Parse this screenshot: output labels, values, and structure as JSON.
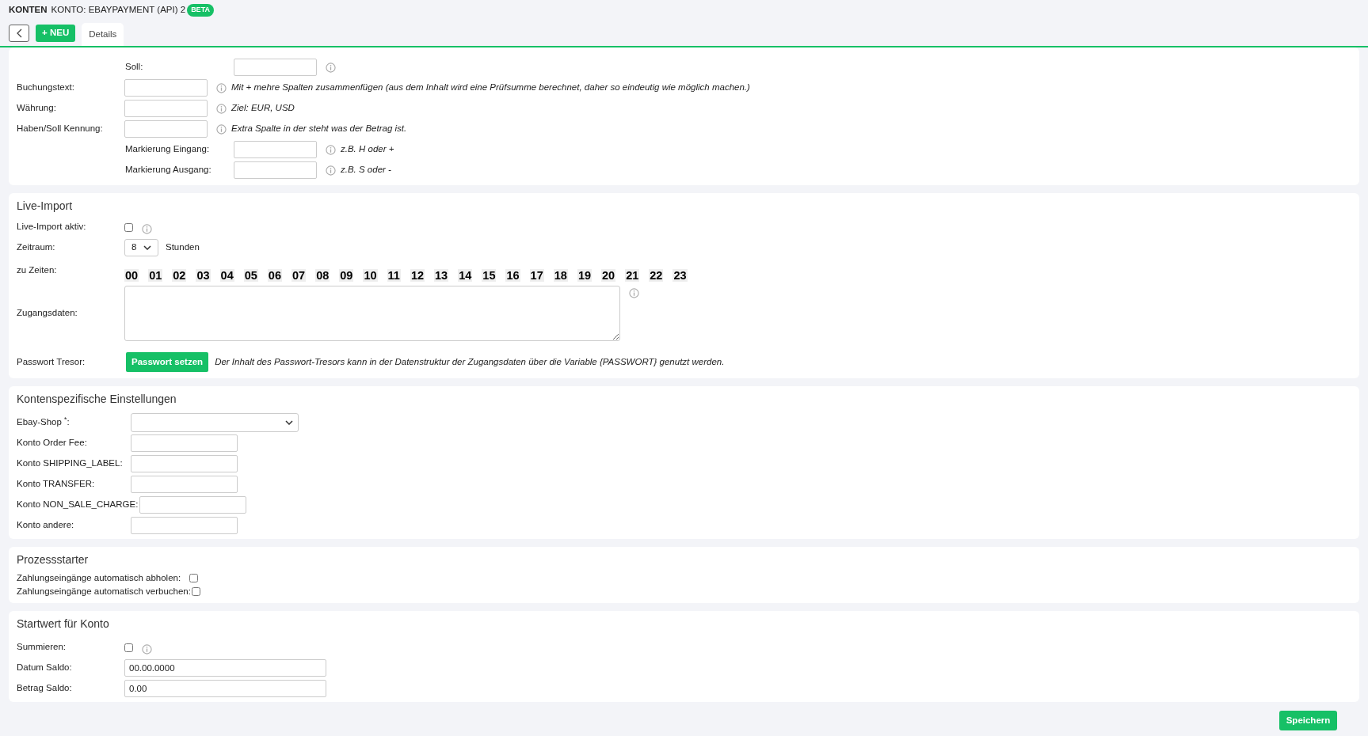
{
  "header": {
    "section": "KONTEN",
    "title": "KONTO: EBAYPAYMENT (API) 2",
    "badge": "BETA"
  },
  "toolbar": {
    "new_button": "+ NEU",
    "tabs": [
      {
        "label": "Details",
        "selected": true
      }
    ]
  },
  "mapping": [
    {
      "kind": "sub",
      "label": "Soll:"
    },
    {
      "kind": "main",
      "label": "Buchungstext:",
      "hint": "Mit + mehre Spalten zusammenfügen (aus dem Inhalt wird eine Prüfsumme berechnet, daher so eindeutig wie möglich machen.)"
    },
    {
      "kind": "main",
      "label": "Währung:",
      "hint": "Ziel: EUR, USD"
    },
    {
      "kind": "main",
      "label": "Haben/Soll Kennung:",
      "hint": "Extra Spalte in der steht was der Betrag ist."
    },
    {
      "kind": "sub",
      "label": "Markierung Eingang:",
      "hint": "z.B. H oder +"
    },
    {
      "kind": "sub",
      "label": "Markierung Ausgang:",
      "hint": "z.B. S oder -"
    }
  ],
  "live_import": {
    "title": "Live-Import",
    "active": {
      "label": "Live-Import aktiv:",
      "checked": false
    },
    "period": {
      "label": "Zeitraum:",
      "value": "8",
      "unit": "Stunden"
    },
    "times": {
      "label": "zu Zeiten:",
      "hours": [
        "00",
        "01",
        "02",
        "03",
        "04",
        "05",
        "06",
        "07",
        "08",
        "09",
        "10",
        "11",
        "12",
        "13",
        "14",
        "15",
        "16",
        "17",
        "18",
        "19",
        "20",
        "21",
        "22",
        "23"
      ]
    },
    "credentials": {
      "label": "Zugangsdaten:"
    },
    "vault": {
      "label": "Passwort Tresor:",
      "button": "Passwort setzen",
      "hint": "Der Inhalt des Passwort-Tresors kann in der Datenstruktur der Zugangsdaten über die Variable {PASSWORT} genutzt werden."
    }
  },
  "account_settings": {
    "title": "Kontenspezifische Einstellungen",
    "fields": [
      {
        "kind": "select",
        "label": "Ebay-Shop $^{*}$:"
      },
      {
        "kind": "text",
        "label": "Konto Order Fee:"
      },
      {
        "kind": "text",
        "label": "Konto SHIPPING_LABEL:"
      },
      {
        "kind": "text",
        "label": "Konto TRANSFER:"
      },
      {
        "kind": "text",
        "label": "Konto NON_SALE_CHARGE:"
      },
      {
        "kind": "text",
        "label": "Konto andere:"
      }
    ]
  },
  "process_starter": {
    "title": "Prozessstarter",
    "items": [
      {
        "label": "Zahlungseingänge automatisch abholen:",
        "checked": false
      },
      {
        "label": "Zahlungseingänge automatisch verbuchen:",
        "checked": false
      }
    ]
  },
  "start_value": {
    "title": "Startwert für Konto",
    "sum": {
      "label": "Summieren:",
      "checked": false
    },
    "fields": [
      {
        "label": "Datum Saldo:",
        "value": "00.00.0000"
      },
      {
        "label": "Betrag Saldo:",
        "value": "0.00"
      }
    ]
  },
  "save_button": "Speichern"
}
